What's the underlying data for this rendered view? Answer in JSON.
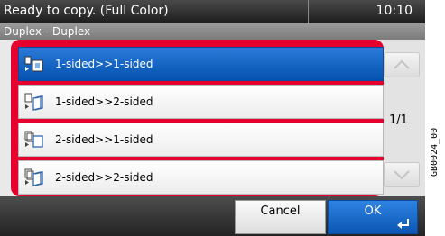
{
  "status": {
    "message": "Ready to copy. (Full Color)",
    "time": "10:10"
  },
  "screen_title": "Duplex - Duplex",
  "options": [
    {
      "label": "1-sided>>1-sided",
      "icon": "duplex-1to1-icon",
      "selected": true
    },
    {
      "label": "1-sided>>2-sided",
      "icon": "duplex-1to2-icon",
      "selected": false
    },
    {
      "label": "2-sided>>1-sided",
      "icon": "duplex-2to1-icon",
      "selected": false
    },
    {
      "label": "2-sided>>2-sided",
      "icon": "duplex-2to2-icon",
      "selected": false
    }
  ],
  "pager": {
    "page": "1/1"
  },
  "buttons": {
    "cancel": "Cancel",
    "ok": "OK"
  },
  "figure_code": "GB0024_00",
  "colors": {
    "highlight": "#e6002e",
    "selected": "#0a5fc4"
  }
}
